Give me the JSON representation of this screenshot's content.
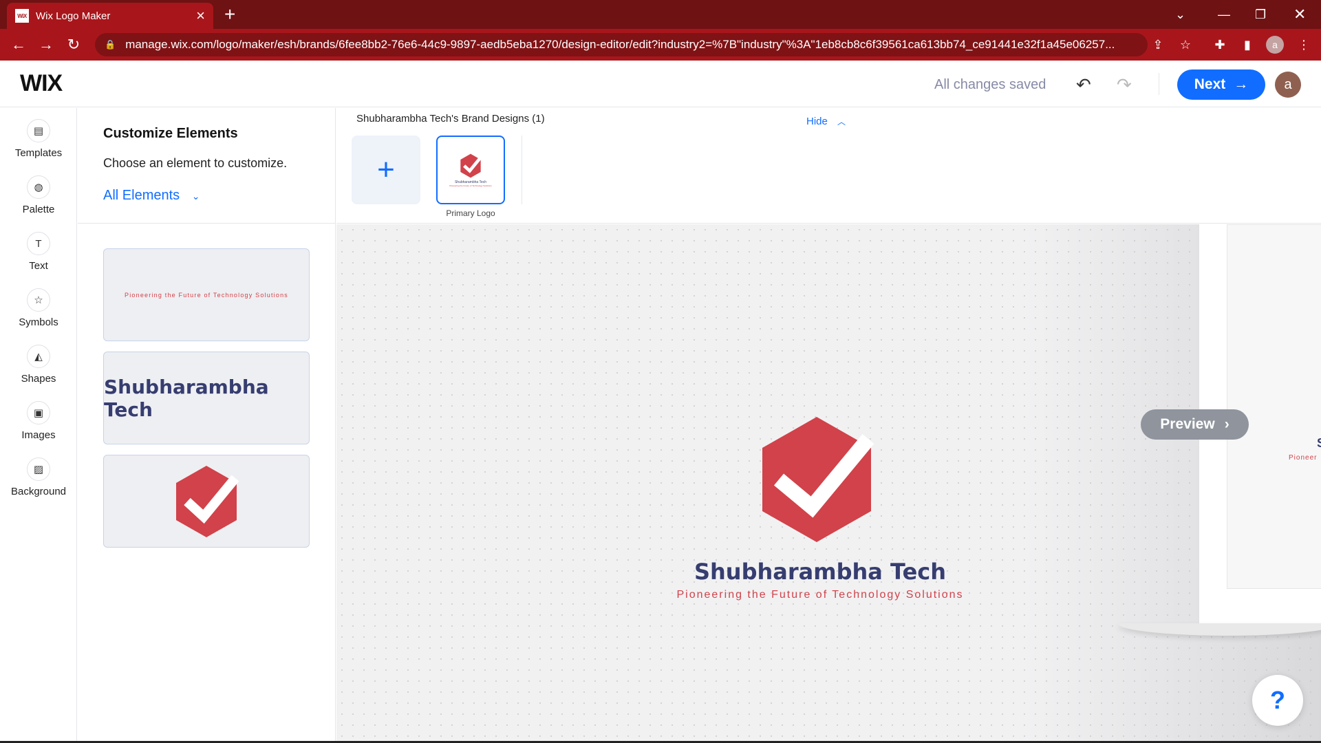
{
  "browser": {
    "tab_title": "Wix Logo Maker",
    "tab_favicon_text": "WiX",
    "url": "manage.wix.com/logo/maker/esh/brands/6fee8bb2-76e6-44c9-9897-aedb5eba1270/design-editor/edit?industry2=%7B\"industry\"%3A\"1eb8cb8c6f39561ca613bb74_ce91441e32f1a45e06257...",
    "profile_initial": "a"
  },
  "header": {
    "logo": "WIX",
    "status": "All changes saved",
    "next_label": "Next",
    "avatar_initial": "a"
  },
  "rail": {
    "items": [
      {
        "label": "Templates",
        "icon": "templates-icon"
      },
      {
        "label": "Palette",
        "icon": "palette-icon"
      },
      {
        "label": "Text",
        "icon": "text-icon"
      },
      {
        "label": "Symbols",
        "icon": "symbols-icon"
      },
      {
        "label": "Shapes",
        "icon": "shapes-icon"
      },
      {
        "label": "Images",
        "icon": "images-icon"
      },
      {
        "label": "Background",
        "icon": "background-icon"
      }
    ]
  },
  "panel": {
    "title": "Customize Elements",
    "subtitle": "Choose an element to customize.",
    "dropdown": "All Elements",
    "cards": {
      "tagline": "Pioneering the Future of Technology Solutions",
      "name": "Shubharambha Tech"
    }
  },
  "designs": {
    "title": "Shubharambha Tech's Brand Designs (1)",
    "hide_label": "Hide",
    "thumb_label": "Primary Logo",
    "thumb_name": "Shubharambha Tech",
    "thumb_tag": "Pioneering the Future of Technology Solutions"
  },
  "canvas": {
    "brand_name": "Shubharambha Tech",
    "tagline": "Pioneering the Future of Technology Solutions",
    "preview_label": "Preview",
    "mock_letter": "S",
    "mock_tag": "Pioneer",
    "help_label": "?"
  },
  "colors": {
    "accent": "#116dff",
    "brand_red": "#d1424a",
    "brand_navy": "#363d70",
    "chrome": "#a8161b"
  }
}
